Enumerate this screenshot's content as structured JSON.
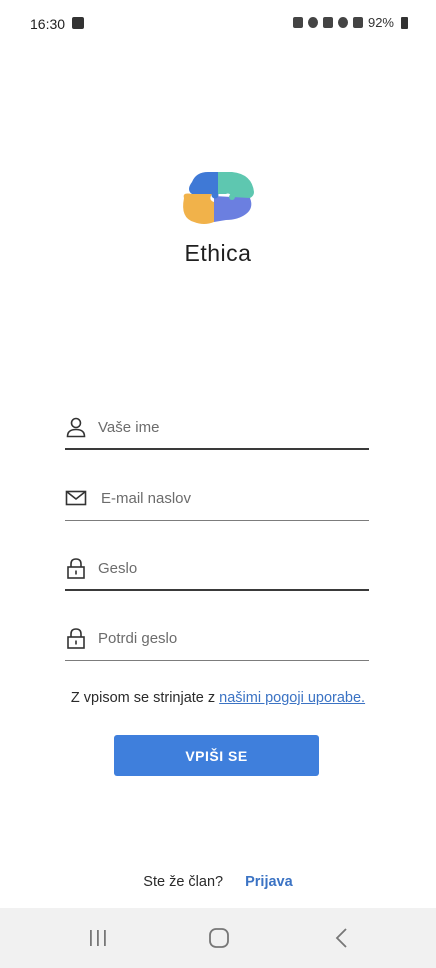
{
  "status_bar": {
    "time": "16:30",
    "battery": "92%"
  },
  "app": {
    "name": "Ethica"
  },
  "form": {
    "name_placeholder": "Vaše ime",
    "email_placeholder": "E-mail naslov",
    "password_placeholder": "Geslo",
    "confirm_placeholder": "Potrdi geslo"
  },
  "terms": {
    "text": "Z vpisom se strinjate z ",
    "link": "našimi pogoji uporabe."
  },
  "signup_button": "VPIŠI SE",
  "login": {
    "question": "Ste že član?",
    "link": "Prijava"
  },
  "colors": {
    "accent": "#3f7fdc",
    "link": "#3b73c4"
  }
}
